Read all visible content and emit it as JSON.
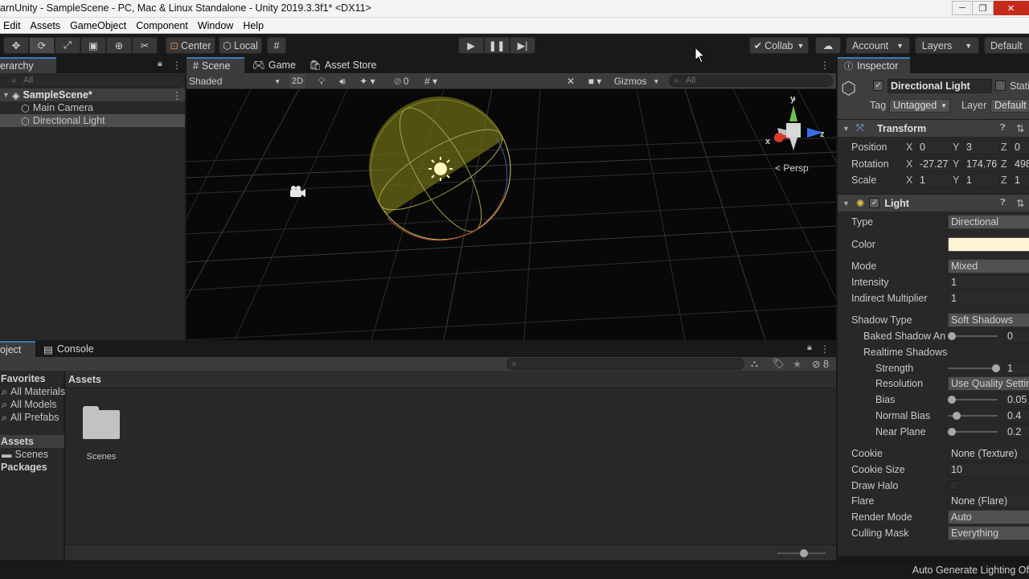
{
  "window": {
    "title": "arnUnity - SampleScene - PC, Mac & Linux Standalone - Unity 2019.3.3f1* <DX11>",
    "controls": [
      "─",
      "❐",
      "✕"
    ]
  },
  "menu": [
    "Edit",
    "Assets",
    "GameObject",
    "Component",
    "Window",
    "Help"
  ],
  "toolbar": {
    "pivot": "Center",
    "space": "Local",
    "collab": "Collab",
    "account": "Account",
    "layers": "Layers",
    "layout": "Default"
  },
  "hierarchy": {
    "tab": "erarchy",
    "search_placeholder": "All",
    "scene": "SampleScene*",
    "items": [
      "Main Camera",
      "Directional Light"
    ]
  },
  "scene": {
    "tabs": [
      "Scene",
      "Game",
      "Asset Store"
    ],
    "draw_mode": "Shaded",
    "mode_2d": "2D",
    "hidden_count": "0",
    "gizmos": "Gizmos",
    "search_placeholder": "All",
    "persp": "Persp",
    "axes": {
      "y": "y",
      "z": "z",
      "x": "x"
    }
  },
  "project": {
    "tabs": [
      "oject",
      "Console"
    ],
    "favorites": "Favorites",
    "favorite_items": [
      "All Materials",
      "All Models",
      "All Prefabs"
    ],
    "assets": "Assets",
    "asset_children": [
      "Scenes"
    ],
    "packages": "Packages",
    "breadcrumb": "Assets",
    "folders": [
      "Scenes"
    ],
    "hidden_count": "8"
  },
  "inspector": {
    "tab": "Inspector",
    "object_name": "Directional Light",
    "static_label": "Stati",
    "tag_label": "Tag",
    "tag": "Untagged",
    "layer_label": "Layer",
    "layer": "Default",
    "transform": {
      "title": "Transform",
      "position_label": "Position",
      "rotation_label": "Rotation",
      "scale_label": "Scale",
      "position": {
        "x": "0",
        "y": "3",
        "z": "0"
      },
      "rotation": {
        "x": "-27.27",
        "y": "174.76",
        "z": "498"
      },
      "scale": {
        "x": "1",
        "y": "1",
        "z": "1"
      }
    },
    "light": {
      "title": "Light",
      "type_label": "Type",
      "type": "Directional",
      "color_label": "Color",
      "color": "#fff4d6",
      "mode_label": "Mode",
      "mode": "Mixed",
      "intensity_label": "Intensity",
      "intensity": "1",
      "indirect_label": "Indirect Multiplier",
      "indirect": "1",
      "shadow_type_label": "Shadow Type",
      "shadow_type": "Soft Shadows",
      "baked_label": "Baked Shadow An",
      "baked": "0",
      "realtime_label": "Realtime Shadows",
      "strength_label": "Strength",
      "strength": "1",
      "resolution_label": "Resolution",
      "resolution": "Use Quality Settin",
      "bias_label": "Bias",
      "bias": "0.05",
      "normal_bias_label": "Normal Bias",
      "normal_bias": "0.4",
      "near_plane_label": "Near Plane",
      "near_plane": "0.2",
      "cookie_label": "Cookie",
      "cookie": "None (Texture)",
      "cookie_size_label": "Cookie Size",
      "cookie_size": "10",
      "draw_halo_label": "Draw Halo",
      "flare_label": "Flare",
      "flare": "None (Flare)",
      "render_mode_label": "Render Mode",
      "render_mode": "Auto",
      "culling_label": "Culling Mask",
      "culling": "Everything"
    }
  },
  "status": "Auto Generate Lighting Of"
}
